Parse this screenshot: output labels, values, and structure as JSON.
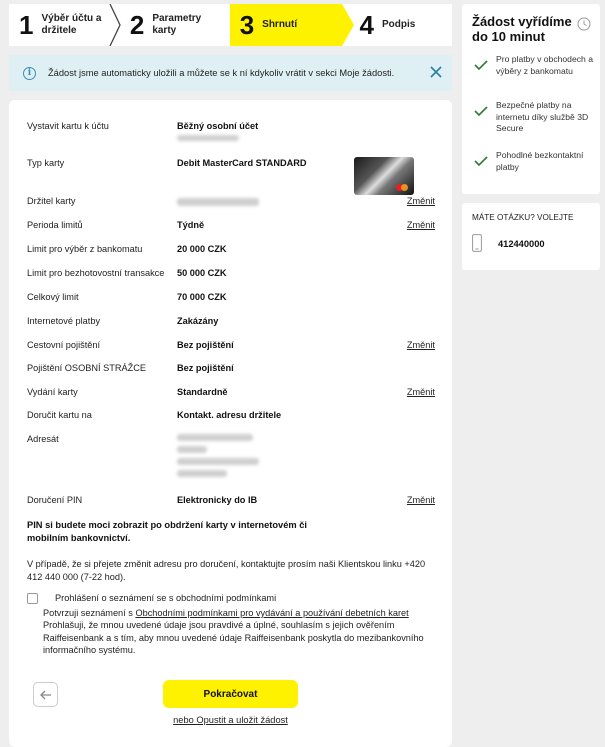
{
  "stepper": {
    "steps": [
      {
        "num": "1",
        "label": "Výběr účtu a držitele"
      },
      {
        "num": "2",
        "label": "Parametry karty"
      },
      {
        "num": "3",
        "label": "Shrnutí"
      },
      {
        "num": "4",
        "label": "Podpis"
      }
    ],
    "active": 3
  },
  "info": {
    "text_prefix": "Žádost jsme automaticky uložili a můžete se k ní kdykoliv vrátit v sekci",
    "text_link": "Moje žádosti."
  },
  "summary": {
    "change_label": "Změnit",
    "rows": [
      {
        "key": "Vystavit kartu k účtu",
        "value": "Běžný osobní účet"
      },
      {
        "key": "Typ karty",
        "value": "Debit MasterCard STANDARD"
      },
      {
        "key": "Držitel karty",
        "value": ""
      },
      {
        "key": "Perioda limitů",
        "value": "Týdně"
      },
      {
        "key": "Limit pro výběr z bankomatu",
        "value": "20 000 CZK"
      },
      {
        "key": "Limit pro bezhotovostní transakce",
        "value": "50 000 CZK"
      },
      {
        "key": "Celkový limit",
        "value": "70 000 CZK"
      },
      {
        "key": "Internetové platby",
        "value": "Zakázány"
      },
      {
        "key": "Cestovní pojištění",
        "value": "Bez pojištění"
      },
      {
        "key": "Pojištění OSOBNÍ STRÁŽCE",
        "value": "Bez pojištění"
      },
      {
        "key": "Vydání karty",
        "value": "Standardně"
      },
      {
        "key": "Doručit kartu na",
        "value": "Kontakt. adresu držitele"
      },
      {
        "key": "Adresát",
        "value": ""
      },
      {
        "key": "Doručení PIN",
        "value": "Elektronicky do IB"
      }
    ]
  },
  "pin_note": "PIN si budete moci zobrazit po obdržení karty v internetovém či mobilním bankovnictví.",
  "contact_note": "V případě, že si přejete změnit adresu pro doručení, kontaktujte prosím naši Klientskou linku +420 412 440 000 (7-22 hod).",
  "consent": {
    "title": "Prohlášení o seznámení se s obchodními podmínkami",
    "line1_prefix": "Potvrzuji seznámení s",
    "line1_link": "Obchodními podmínkami pro vydávání a používání debetních karet",
    "rest": "Prohlašuji, že mnou uvedené údaje jsou pravdivé a úplné, souhlasím s jejich ověřením Raiffeisenbank a s tím, aby mnou uvedené údaje Raiffeisenbank poskytla do mezibankovního informačního systému."
  },
  "actions": {
    "back_icon": "arrow-left-icon",
    "continue_label": "Pokračovat",
    "secondary_label": "nebo Opustit a uložit žádost"
  },
  "side": {
    "title": "Žádost vyřídíme do 10 minut",
    "features": [
      "Pro platby v obchodech a výběry z bankomatu",
      "Bezpečné platby na internetu díky službě 3D Secure",
      "Pohodlné bezkontaktní platby"
    ],
    "questions_label": "MÁTE OTÁZKU? VOLEJTE",
    "phone": "412440000"
  },
  "colors": {
    "accent": "#fff200",
    "info_bg": "#dff0f5",
    "check": "#2e7d32"
  }
}
